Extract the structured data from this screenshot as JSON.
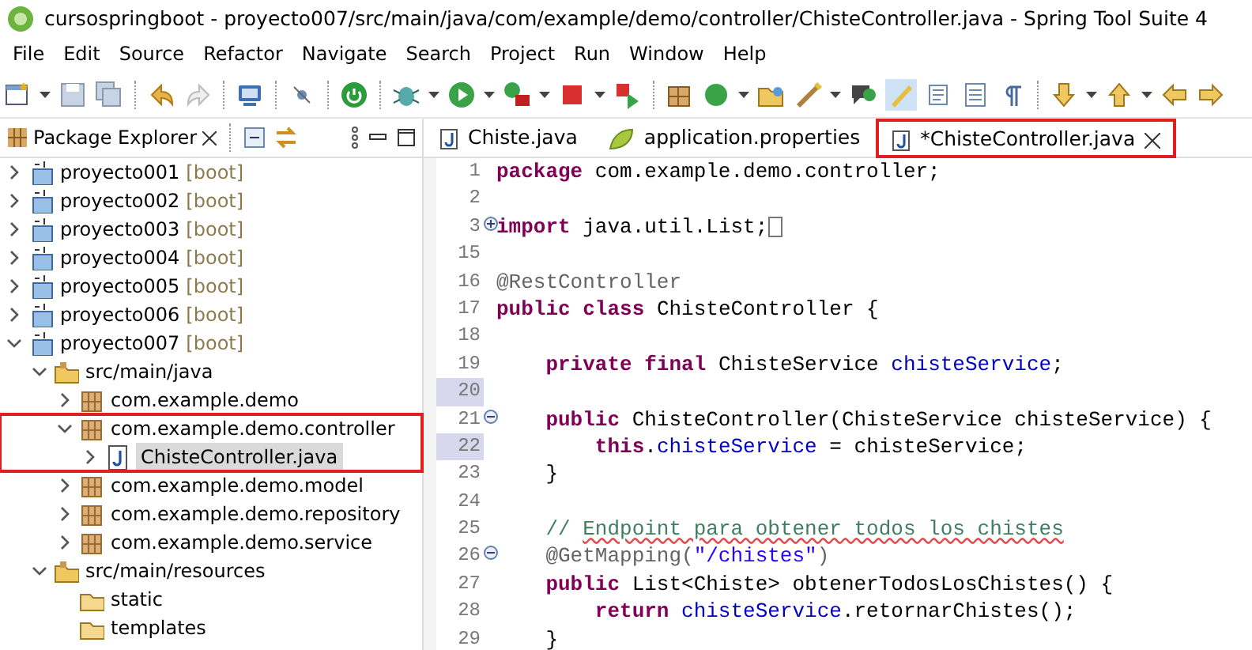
{
  "window": {
    "title": "cursospringboot - proyecto007/src/main/java/com/example/demo/controller/ChisteController.java - Spring Tool Suite 4"
  },
  "menu": [
    {
      "label": "File"
    },
    {
      "label": "Edit"
    },
    {
      "label": "Source"
    },
    {
      "label": "Refactor"
    },
    {
      "label": "Navigate"
    },
    {
      "label": "Search"
    },
    {
      "label": "Project"
    },
    {
      "label": "Run"
    },
    {
      "label": "Window"
    },
    {
      "label": "Help"
    }
  ],
  "package_explorer": {
    "title": "Package Explorer",
    "tree": [
      {
        "kind": "project",
        "label": "proyecto001",
        "suffix": "[boot]",
        "expanded": false,
        "selected": false,
        "highlighted": false
      },
      {
        "kind": "project",
        "label": "proyecto002",
        "suffix": "[boot]",
        "expanded": false,
        "selected": false,
        "highlighted": false
      },
      {
        "kind": "project",
        "label": "proyecto003",
        "suffix": "[boot]",
        "expanded": false,
        "selected": false,
        "highlighted": false
      },
      {
        "kind": "project",
        "label": "proyecto004",
        "suffix": "[boot]",
        "expanded": false,
        "selected": false,
        "highlighted": false
      },
      {
        "kind": "project",
        "label": "proyecto005",
        "suffix": "[boot]",
        "expanded": false,
        "selected": false,
        "highlighted": false
      },
      {
        "kind": "project",
        "label": "proyecto006",
        "suffix": "[boot]",
        "expanded": false,
        "selected": false,
        "highlighted": false
      },
      {
        "kind": "project",
        "label": "proyecto007",
        "suffix": "[boot]",
        "expanded": true,
        "selected": false,
        "highlighted": false,
        "children": [
          {
            "kind": "source-folder",
            "label": "src/main/java",
            "expanded": true,
            "selected": false,
            "highlighted": false,
            "children": [
              {
                "kind": "package",
                "label": "com.example.demo",
                "expanded": false,
                "selected": false,
                "highlighted": false
              },
              {
                "kind": "package",
                "label": "com.example.demo.controller",
                "expanded": true,
                "selected": false,
                "highlighted": true,
                "children": [
                  {
                    "kind": "java-file",
                    "label": "ChisteController.java",
                    "expanded": false,
                    "selected": true,
                    "highlighted": false
                  }
                ]
              },
              {
                "kind": "package",
                "label": "com.example.demo.model",
                "expanded": false,
                "selected": false,
                "highlighted": false
              },
              {
                "kind": "package",
                "label": "com.example.demo.repository",
                "expanded": false,
                "selected": false,
                "highlighted": false
              },
              {
                "kind": "package",
                "label": "com.example.demo.service",
                "expanded": false,
                "selected": false,
                "highlighted": false
              }
            ]
          },
          {
            "kind": "source-folder",
            "label": "src/main/resources",
            "expanded": true,
            "selected": false,
            "highlighted": false,
            "children": [
              {
                "kind": "folder",
                "label": "static",
                "selected": false,
                "highlighted": false
              },
              {
                "kind": "folder",
                "label": "templates",
                "selected": false,
                "highlighted": false
              }
            ]
          }
        ]
      }
    ]
  },
  "editor_tabs": [
    {
      "kind": "java",
      "label": "Chiste.java",
      "selected": false,
      "highlighted": false
    },
    {
      "kind": "properties",
      "label": "application.properties",
      "selected": false,
      "highlighted": false
    },
    {
      "kind": "java",
      "label": "*ChisteController.java",
      "selected": true,
      "highlighted": true
    }
  ],
  "code_lines": [
    {
      "number": "1",
      "changed": false,
      "tokens": [
        {
          "kind": "keyword",
          "text": "package"
        },
        {
          "kind": "plain",
          "text": "com.example.demo.controller;"
        }
      ]
    },
    {
      "number": "2",
      "changed": false
    },
    {
      "number": "3",
      "changed": false,
      "foldable": true,
      "folded": true,
      "tokens": [
        {
          "kind": "keyword",
          "text": "import"
        },
        {
          "kind": "plain",
          "text": "java.util.List;"
        }
      ]
    },
    {
      "number": "15",
      "changed": false
    },
    {
      "number": "16",
      "changed": false,
      "tokens": [
        {
          "kind": "annotation",
          "text": "@RestController"
        }
      ]
    },
    {
      "number": "17",
      "changed": false,
      "tokens": [
        {
          "kind": "keyword",
          "text": "public class"
        },
        {
          "kind": "plain",
          "text": "ChisteController {"
        }
      ]
    },
    {
      "number": "18",
      "changed": false
    },
    {
      "number": "19",
      "changed": false,
      "tokens": [
        {
          "kind": "keyword",
          "text": "    private final"
        },
        {
          "kind": "plain",
          "text": "ChisteService"
        },
        {
          "kind": "field",
          "text": "chisteService"
        },
        {
          "kind": "plain",
          "text": ";"
        }
      ]
    },
    {
      "number": "20",
      "changed": true
    },
    {
      "number": "21",
      "changed": false,
      "foldable": true,
      "folded": false,
      "tokens": [
        {
          "kind": "keyword",
          "text": "    public"
        },
        {
          "kind": "plain",
          "text": "ChisteController(ChisteService chisteService) {"
        }
      ]
    },
    {
      "number": "22",
      "changed": true,
      "tokens": [
        {
          "kind": "keyword",
          "text": "        this"
        },
        {
          "kind": "plain",
          "text": "."
        },
        {
          "kind": "field",
          "text": "chisteService"
        },
        {
          "kind": "plain",
          "text": "= chisteService;"
        }
      ]
    },
    {
      "number": "23",
      "changed": false,
      "tokens": [
        {
          "kind": "plain",
          "text": "    }"
        }
      ]
    },
    {
      "number": "24",
      "changed": false
    },
    {
      "number": "25",
      "changed": false,
      "tokens": [
        {
          "kind": "comment",
          "text": "    //"
        },
        {
          "kind": "comment-misspelled",
          "text": "Endpoint para obtener todos los chistes"
        }
      ]
    },
    {
      "number": "26",
      "changed": false,
      "foldable": true,
      "folded": false,
      "tokens": [
        {
          "kind": "annotation",
          "text": "    @GetMapping("
        },
        {
          "kind": "string",
          "text": "\"/chistes\""
        },
        {
          "kind": "annotation",
          "text": ")"
        }
      ]
    },
    {
      "number": "27",
      "changed": false,
      "tokens": [
        {
          "kind": "keyword",
          "text": "    public"
        },
        {
          "kind": "plain",
          "text": "List<Chiste> obtenerTodosLosChistes() {"
        }
      ]
    },
    {
      "number": "28",
      "changed": false,
      "tokens": [
        {
          "kind": "keyword",
          "text": "        return"
        },
        {
          "kind": "field",
          "text": "chisteService"
        },
        {
          "kind": "plain",
          "text": ".retornarChistes();"
        }
      ]
    },
    {
      "number": "29",
      "changed": false,
      "tokens": [
        {
          "kind": "plain",
          "text": "    }"
        }
      ]
    }
  ]
}
